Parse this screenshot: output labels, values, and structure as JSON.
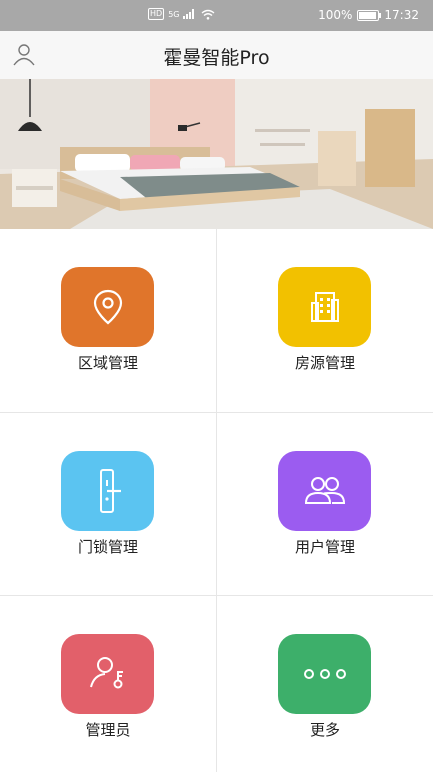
{
  "status_bar": {
    "hd": "HD",
    "network": "5G",
    "battery_percent": "100%",
    "time": "17:32"
  },
  "header": {
    "title": "霍曼智能Pro",
    "user_icon": "user-icon"
  },
  "banner": {
    "image": "bedroom-photo"
  },
  "menu": [
    {
      "label": "区域管理",
      "icon": "location-pin-icon",
      "color": "#E0752B"
    },
    {
      "label": "房源管理",
      "icon": "building-icon",
      "color": "#F2C100"
    },
    {
      "label": "门锁管理",
      "icon": "door-lock-icon",
      "color": "#5BC4F1"
    },
    {
      "label": "用户管理",
      "icon": "users-icon",
      "color": "#9B5CF0"
    },
    {
      "label": "管理员",
      "icon": "admin-key-icon",
      "color": "#E2606A"
    },
    {
      "label": "更多",
      "icon": "more-dots-icon",
      "color": "#3DAF6A"
    }
  ]
}
